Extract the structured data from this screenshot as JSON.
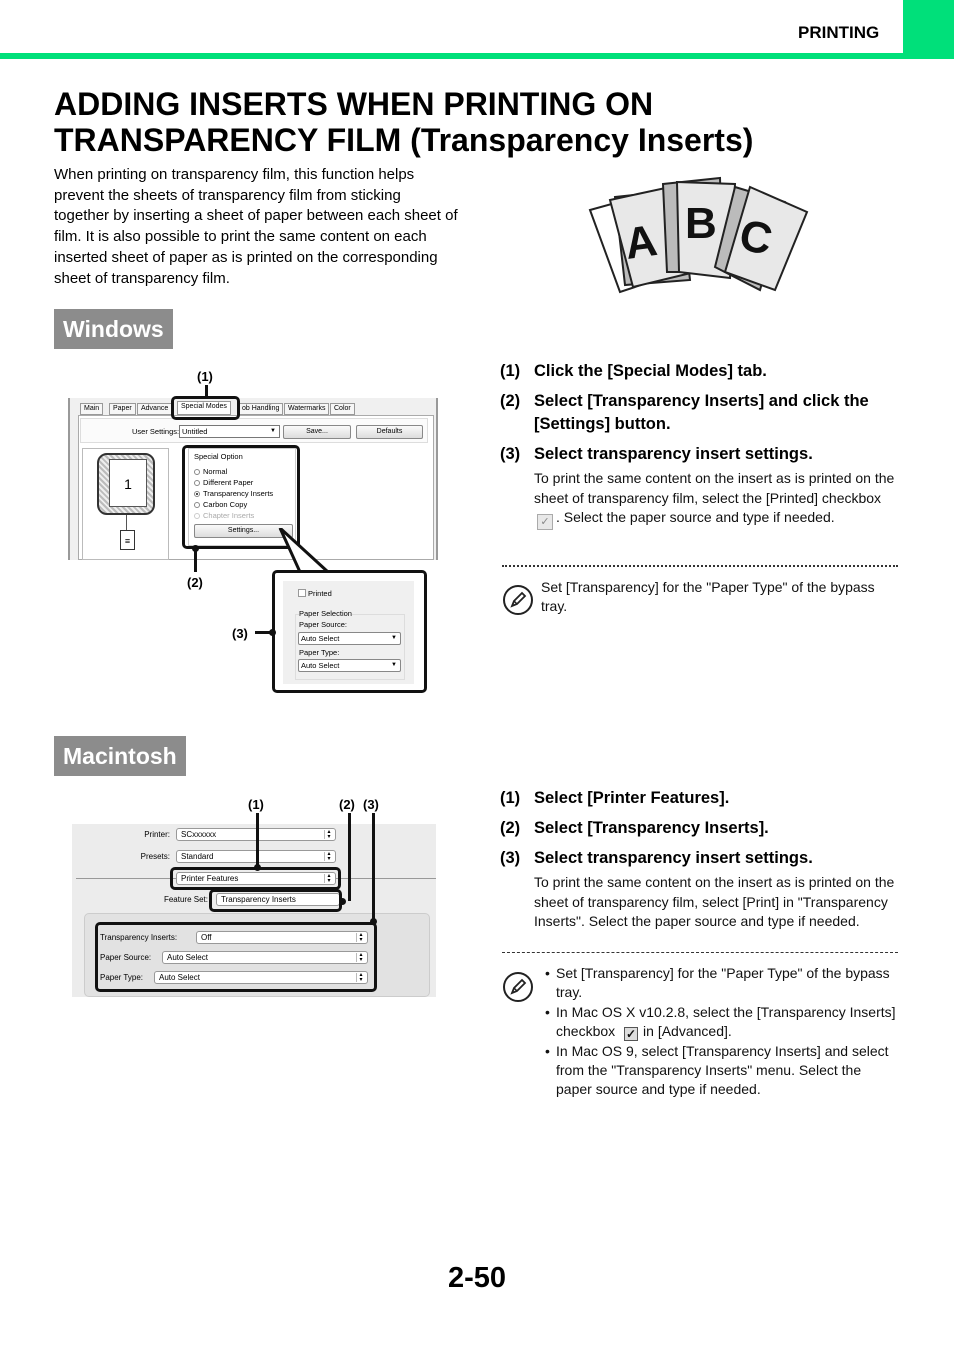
{
  "header": {
    "section": "PRINTING",
    "accent_color": "#00e07a"
  },
  "title": {
    "line1": "ADDING INSERTS WHEN PRINTING ON",
    "line2": "TRANSPARENCY FILM (Transparency Inserts)"
  },
  "intro": "When printing on transparency film, this function helps prevent the sheets of transparency film from sticking together by inserting a sheet of paper between each sheet of film. It is also possible to print the same content on each inserted sheet of paper as is printed on the corresponding sheet of transparency film.",
  "illustration": {
    "letters": [
      "A",
      "B",
      "C"
    ]
  },
  "windows": {
    "badge": "Windows",
    "callouts": [
      "(1)",
      "(2)",
      "(3)"
    ],
    "dialog": {
      "tabs": [
        "Main",
        "Paper",
        "Advance",
        "Special Modes",
        "ob Handling",
        "Watermarks",
        "Color"
      ],
      "user_settings_label": "User Settings:",
      "user_settings_value": "Untitled",
      "save_button": "Save...",
      "defaults_button": "Defaults",
      "preview_page": "1",
      "special_option_label": "Special Option",
      "options": [
        {
          "label": "Normal",
          "selected": false,
          "enabled": true
        },
        {
          "label": "Different Paper",
          "selected": false,
          "enabled": true
        },
        {
          "label": "Transparency Inserts",
          "selected": true,
          "enabled": true
        },
        {
          "label": "Carbon Copy",
          "selected": false,
          "enabled": true
        },
        {
          "label": "Chapter Inserts",
          "selected": false,
          "enabled": false
        }
      ],
      "settings_button": "Settings..."
    },
    "popup": {
      "printed_label": "Printed",
      "printed_checked": false,
      "paper_selection_label": "Paper Selection",
      "paper_source_label": "Paper Source:",
      "paper_source_value": "Auto Select",
      "paper_type_label": "Paper Type:",
      "paper_type_value": "Auto Select"
    },
    "steps": [
      {
        "num": "(1)",
        "text": "Click the [Special Modes] tab."
      },
      {
        "num": "(2)",
        "text": "Select [Transparency Inserts] and click the [Settings] button."
      },
      {
        "num": "(3)",
        "text": "Select transparency insert settings."
      }
    ],
    "step3_desc_a": "To print the same content on the insert as is printed on the sheet of transparency film, select the [Printed] checkbox",
    "step3_desc_b": ". Select the paper source and type if needed.",
    "note": "Set [Transparency] for the \"Paper Type\" of the bypass tray."
  },
  "mac": {
    "badge": "Macintosh",
    "callouts": [
      "(1)",
      "(2)",
      "(3)"
    ],
    "dialog": {
      "printer_label": "Printer:",
      "printer_value": "SCxxxxxx",
      "presets_label": "Presets:",
      "presets_value": "Standard",
      "panel_value": "Printer Features",
      "feature_set_label": "Feature Set:",
      "feature_set_value": "Transparency Inserts",
      "transparency_inserts_label": "Transparency Inserts:",
      "transparency_inserts_value": "Off",
      "paper_source_label": "Paper Source:",
      "paper_source_value": "Auto Select",
      "paper_type_label": "Paper Type:",
      "paper_type_value": "Auto Select"
    },
    "steps": [
      {
        "num": "(1)",
        "text": "Select [Printer Features]."
      },
      {
        "num": "(2)",
        "text": "Select [Transparency Inserts]."
      },
      {
        "num": "(3)",
        "text": "Select transparency insert settings."
      }
    ],
    "step3_desc": "To print the same content on the insert as is printed on the sheet of transparency film, select [Print] in \"Transparency Inserts\". Select the paper source and type if needed.",
    "notes": {
      "n1": "Set [Transparency] for the \"Paper Type\" of the bypass tray.",
      "n2a": "In Mac OS X v10.2.8, select the [Transparency Inserts] checkbox",
      "n2b": "in [Advanced].",
      "n3": "In Mac OS 9, select [Transparency Inserts] and select from the \"Transparency Inserts\" menu. Select the paper source and type if needed."
    }
  },
  "footer": {
    "page_number": "2-50"
  }
}
